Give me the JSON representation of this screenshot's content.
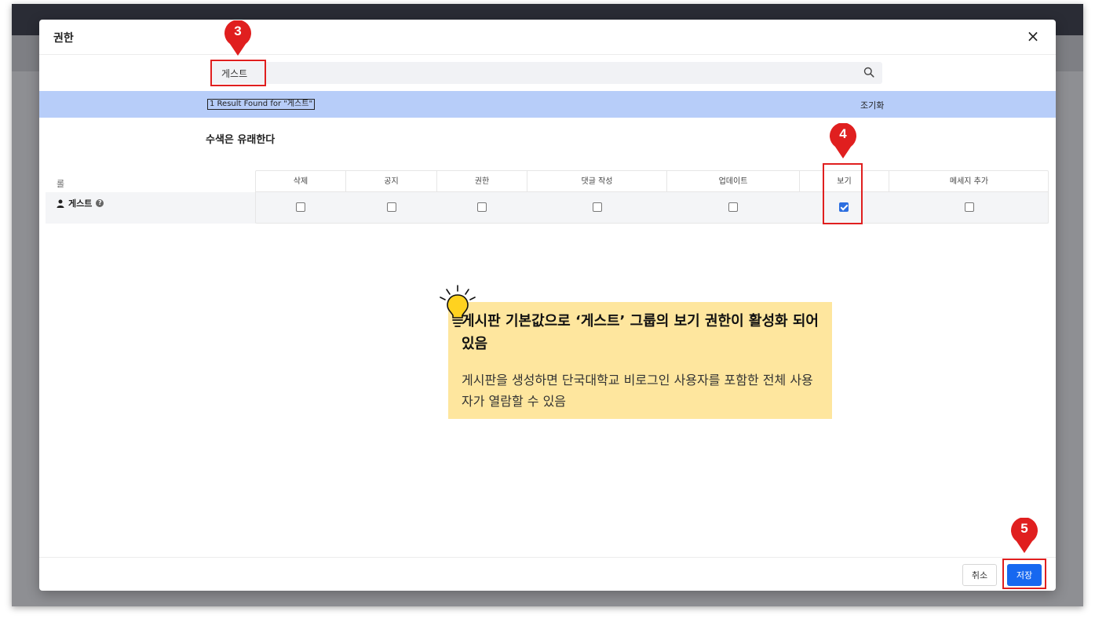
{
  "modal": {
    "title": "권한",
    "close_glyph": "×"
  },
  "search": {
    "value": "게스트"
  },
  "results": {
    "found_text": "1 Result Found for \"게스트\"",
    "reset_label": "조기화"
  },
  "section_title": "수색은 유래한다",
  "table": {
    "role_header": "롤",
    "columns": [
      "삭제",
      "공지",
      "권한",
      "댓글 작성",
      "업데이트",
      "보기",
      "메세지 추가"
    ],
    "rows": [
      {
        "name": "게스트",
        "help_glyph": "?",
        "checked": [
          false,
          false,
          false,
          false,
          false,
          true,
          false
        ]
      }
    ]
  },
  "footer": {
    "cancel_label": "취소",
    "save_label": "저장"
  },
  "annotations": {
    "marker_3": "3",
    "marker_4": "4",
    "marker_5": "5",
    "highlight_color": "#e01f1f"
  },
  "tip": {
    "title": "게시판 기본값으로 ‘게스트’ 그룹의 보기 권한이 활성화 되어있음",
    "body": "게시판을 생성하면 단국대학교 비로그인 사용자를 포함한 전체 사용자가 열람할 수 있음"
  },
  "colors": {
    "accent": "#1768f0",
    "result_bar": "#b7cdf9",
    "tip_bg": "#fee69e",
    "checkbox_checked": "#2d6fe0"
  }
}
